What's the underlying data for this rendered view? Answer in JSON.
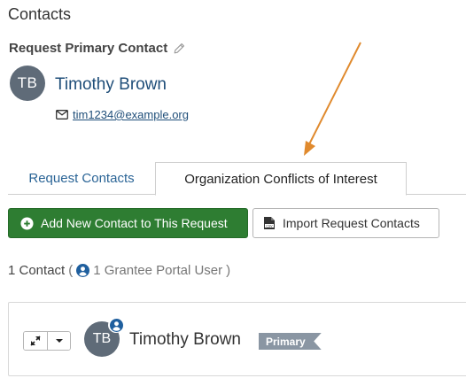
{
  "page": {
    "title": "Contacts"
  },
  "primary_contact": {
    "label": "Request Primary Contact",
    "initials": "TB",
    "name": "Timothy Brown",
    "email": "tim1234@example.org"
  },
  "tabs": [
    {
      "label": "Request Contacts",
      "active": false
    },
    {
      "label": "Organization Conflicts of Interest",
      "active": true
    }
  ],
  "toolbar": {
    "add_label": "Add New Contact to This Request",
    "import_label": "Import Request Contacts"
  },
  "summary": {
    "count_text": "1 Contact",
    "open_paren": "(",
    "portal_users": "1 Grantee Portal User",
    "close_paren": ")"
  },
  "contact_card": {
    "initials": "TB",
    "name": "Timothy Brown",
    "tag": "Primary"
  },
  "colors": {
    "link_blue": "#1f4e79",
    "success_green": "#2e7d32",
    "avatar_grey": "#5f6b78",
    "annotation_orange": "#e08a2e"
  }
}
